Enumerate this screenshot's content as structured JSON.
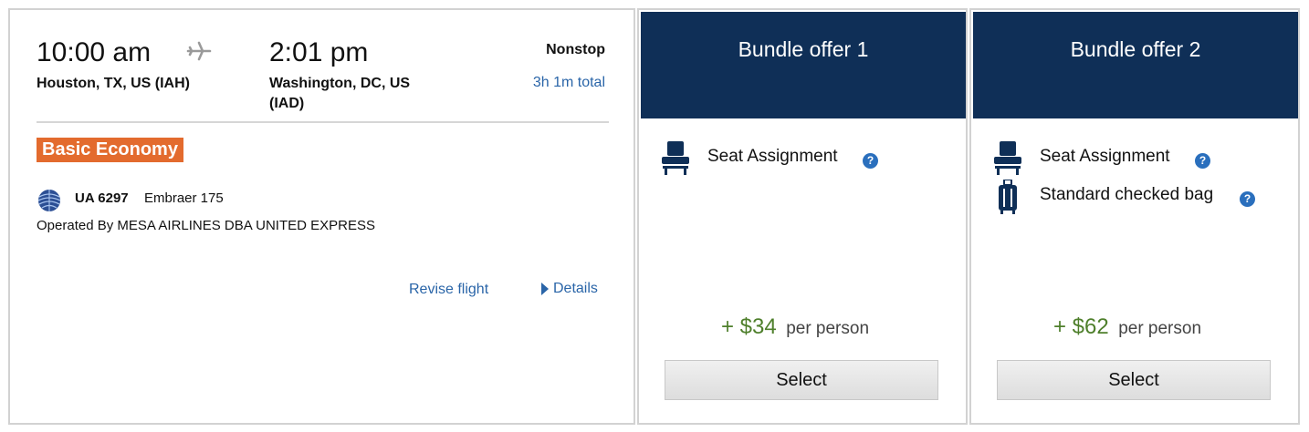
{
  "flight": {
    "depart_time": "10:00 am",
    "depart_city": "Houston, TX, US (IAH)",
    "arrive_time": "2:01 pm",
    "arrive_city_line1": "Washington, DC, US",
    "arrive_city_line2": "(IAD)",
    "stops": "Nonstop",
    "duration": "3h 1m total",
    "cabin": "Basic Economy",
    "flight_number": "UA 6297",
    "aircraft": "Embraer 175",
    "operated_by": "Operated By MESA AIRLINES DBA UNITED EXPRESS",
    "revise_label": "Revise flight",
    "details_label": "Details"
  },
  "bundles": [
    {
      "title": "Bundle offer 1",
      "features": [
        {
          "label": "Seat Assignment",
          "icon": "seat-icon"
        }
      ],
      "price": "+ $34",
      "price_note": "per person",
      "select_label": "Select"
    },
    {
      "title": "Bundle offer 2",
      "features": [
        {
          "label": "Seat Assignment",
          "icon": "seat-icon"
        },
        {
          "label": "Standard checked bag",
          "icon": "luggage-icon"
        }
      ],
      "price": "+ $62",
      "price_note": "per person",
      "select_label": "Select"
    }
  ],
  "colors": {
    "brand_navy": "#0f2f57",
    "cabin_orange": "#e36b2e",
    "link_blue": "#2a65a8",
    "price_green": "#4e7f2b",
    "help_blue": "#2a6fbd"
  }
}
